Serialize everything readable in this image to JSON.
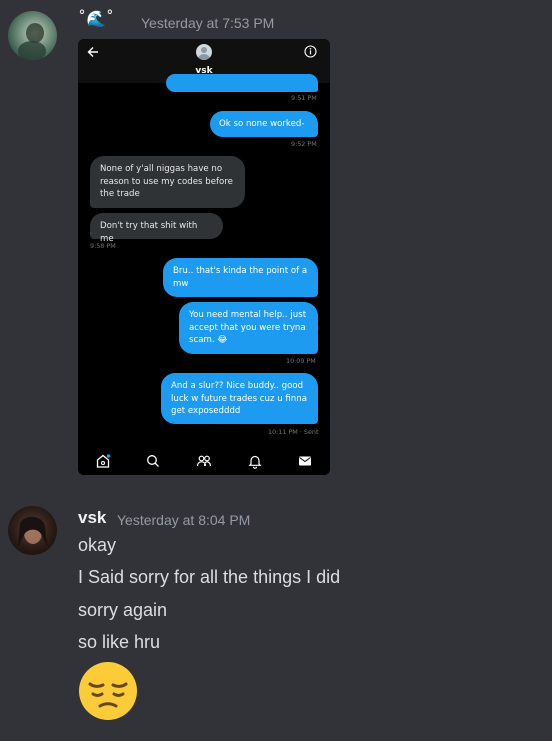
{
  "message1": {
    "username_glyph": "˚🌊˚",
    "timestamp": "Yesterday at 7:53 PM"
  },
  "phone": {
    "header_name": "vsk",
    "messages": [
      {
        "text": "Ok so none worked-",
        "side": "right"
      },
      {
        "text": "None of y'all niggas have no reason to use my codes before the trade",
        "side": "left"
      },
      {
        "text": "Don't try that shit with me",
        "side": "left"
      },
      {
        "text": "Bru.. that's kinda the point of a mw",
        "side": "right"
      },
      {
        "text": "You need mental help.. just accept that you were tryna scam. 😂",
        "side": "right"
      },
      {
        "text": "And a slur?? Nice buddy.. good luck w future trades cuz u finna get exposedddd",
        "side": "right"
      }
    ],
    "times": [
      "9:51 PM",
      "9:52 PM",
      "9:58 PM",
      "10:09 PM",
      "10:11 PM · Sent"
    ],
    "icons": [
      "home-icon",
      "search-icon",
      "people-icon",
      "bell-icon",
      "mail-icon"
    ]
  },
  "message2": {
    "username": "vsk",
    "timestamp": "Yesterday at 8:04 PM",
    "lines": [
      "okay",
      "I Said sorry for all the things I did",
      "sorry again",
      "so like hru"
    ],
    "emoji": "😔"
  },
  "colors": {
    "background": "#313338",
    "bubble_blue": "#1d9bf0",
    "bubble_gray": "#2f3336"
  }
}
